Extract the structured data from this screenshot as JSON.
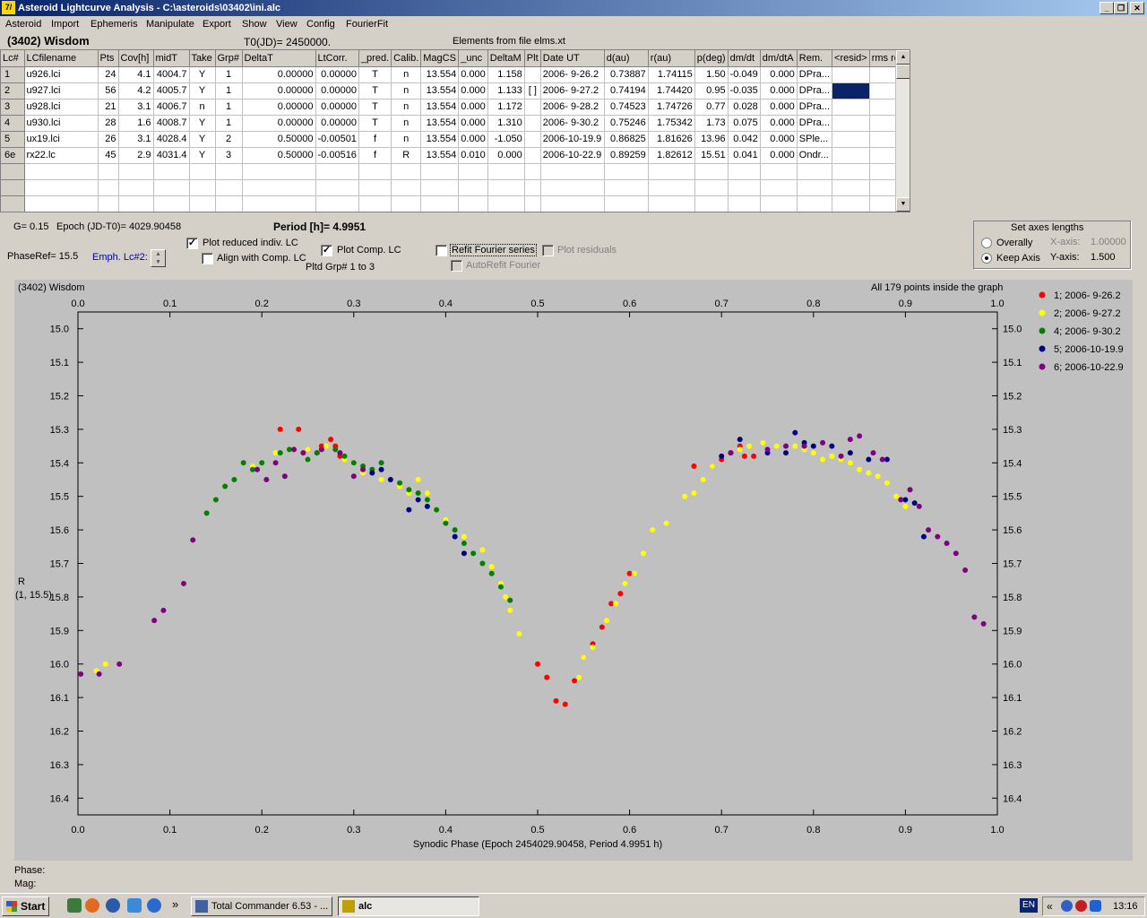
{
  "window": {
    "title": "Asteroid Lightcurve Analysis - C:\\asteroids\\03402\\ini.alc",
    "icon_label": "7/",
    "btn_min": "_",
    "btn_max": "❐",
    "btn_close": "✕"
  },
  "menu": [
    "Asteroid",
    "Import",
    "Ephemeris",
    "Manipulate",
    "Export",
    "Show",
    "View",
    "Config",
    "FourierFit"
  ],
  "header": {
    "asteroid_name": "(3402) Wisdom",
    "t0": "T0(JD)= 2450000.",
    "elements": "Elements from file elms.xt"
  },
  "table": {
    "columns": [
      "Lc#",
      "LCfilename",
      "Pts",
      "Cov[h]",
      "midT",
      "Take",
      "Grp#",
      "DeltaT",
      "LtCorr.",
      "_pred.",
      "Calib.",
      "MagCS",
      "_unc",
      "DeltaM",
      "Plt",
      "Date UT",
      "d(au)",
      "r(au)",
      "p(deg)",
      "dm/dt",
      "dm/dtA",
      "Rem.",
      "<resid>",
      "rms res"
    ],
    "rows": [
      [
        "1",
        "u926.lci",
        "24",
        "4.1",
        "4004.7",
        "Y",
        "1",
        "0.00000",
        "0.00000",
        "T",
        "n",
        "13.554",
        "0.000",
        "1.158",
        "",
        "2006- 9-26.2",
        "0.73887",
        "1.74115",
        "1.50",
        "-0.049",
        "0.000",
        "DPra...",
        "",
        ""
      ],
      [
        "2",
        "u927.lci",
        "56",
        "4.2",
        "4005.7",
        "Y",
        "1",
        "0.00000",
        "0.00000",
        "T",
        "n",
        "13.554",
        "0.000",
        "1.133",
        "[ ]",
        "2006- 9-27.2",
        "0.74194",
        "1.74420",
        "0.95",
        "-0.035",
        "0.000",
        "DPra...",
        "",
        ""
      ],
      [
        "3",
        "u928.lci",
        "21",
        "3.1",
        "4006.7",
        "n",
        "1",
        "0.00000",
        "0.00000",
        "T",
        "n",
        "13.554",
        "0.000",
        "1.172",
        "",
        "2006- 9-28.2",
        "0.74523",
        "1.74726",
        "0.77",
        "0.028",
        "0.000",
        "DPra...",
        "",
        ""
      ],
      [
        "4",
        "u930.lci",
        "28",
        "1.6",
        "4008.7",
        "Y",
        "1",
        "0.00000",
        "0.00000",
        "T",
        "n",
        "13.554",
        "0.000",
        "1.310",
        "",
        "2006- 9-30.2",
        "0.75246",
        "1.75342",
        "1.73",
        "0.075",
        "0.000",
        "DPra...",
        "",
        ""
      ],
      [
        "5",
        "ux19.lci",
        "26",
        "3.1",
        "4028.4",
        "Y",
        "2",
        "0.50000",
        "-0.00501",
        "f",
        "n",
        "13.554",
        "0.000",
        "-1.050",
        "",
        "2006-10-19.9",
        "0.86825",
        "1.81626",
        "13.96",
        "0.042",
        "0.000",
        "SPle...",
        "",
        ""
      ],
      [
        "6e",
        "rx22.lc",
        "45",
        "2.9",
        "4031.4",
        "Y",
        "3",
        "0.50000",
        "-0.00516",
        "f",
        "R",
        "13.554",
        "0.010",
        "0.000",
        "",
        "2006-10-22.9",
        "0.89259",
        "1.82612",
        "15.51",
        "0.041",
        "0.000",
        "Ondr...",
        "",
        ""
      ]
    ],
    "empty_rows": 3,
    "scroll_up": "▲",
    "scroll_down": "▼"
  },
  "params": {
    "g": "G= 0.15",
    "epoch": "Epoch (JD-T0)= 4029.90458",
    "period": "Period [h]= 4.9951",
    "phaseref": "PhaseRef= 15.5",
    "emph": "Emph. Lc#2:",
    "plot_reduced": "Plot reduced indiv. LC",
    "plot_reduced_checked": true,
    "align_comp": "Align with Comp. LC",
    "plot_comp": "Plot Comp. LC",
    "plot_comp_checked": true,
    "refit_fourier": "Refit Fourier series",
    "plot_residuals": "Plot residuals",
    "autorefit": "AutoRefit Fourier",
    "pltd_grp": "Pltd Grp#  1   to    3",
    "check_mark": "✓"
  },
  "axes_box": {
    "title": "Set axes lengths",
    "overally": "Overally",
    "keep_axis": "Keep Axis",
    "x_label": "X-axis:",
    "x_value": "1.00000",
    "y_label": "Y-axis:",
    "y_value": "1.500"
  },
  "status": {
    "phase": "Phase:",
    "mag": "Mag:"
  },
  "chart_data": {
    "type": "scatter",
    "title": "(3402) Wisdom",
    "annotation": "All 179 points inside the graph",
    "xlabel": "Synodic Phase (Epoch 2454029.90458, Period 4.9951 h)",
    "ylabel": "R",
    "ylabel2": "(1, 15.5)",
    "xlim": [
      0.0,
      1.0
    ],
    "ylim": [
      16.45,
      14.95
    ],
    "y_inverted": true,
    "x_ticks": [
      "0.0",
      "0.1",
      "0.2",
      "0.3",
      "0.4",
      "0.5",
      "0.6",
      "0.7",
      "0.8",
      "0.9",
      "1.0"
    ],
    "y_ticks": [
      "15.0",
      "15.1",
      "15.2",
      "15.3",
      "15.4",
      "15.5",
      "15.6",
      "15.7",
      "15.8",
      "15.9",
      "16.0",
      "16.1",
      "16.2",
      "16.3",
      "16.4"
    ],
    "y_tick_values": [
      15.0,
      15.1,
      15.2,
      15.3,
      15.4,
      15.5,
      15.6,
      15.7,
      15.8,
      15.9,
      16.0,
      16.1,
      16.2,
      16.3,
      16.4
    ],
    "grid": false,
    "legend_position": "right",
    "series": [
      {
        "name": "1; 2006- 9-26.2",
        "color": "#ff0000",
        "points": [
          [
            0.22,
            15.3
          ],
          [
            0.24,
            15.3
          ],
          [
            0.25,
            15.36
          ],
          [
            0.26,
            15.37
          ],
          [
            0.265,
            15.35
          ],
          [
            0.275,
            15.33
          ],
          [
            0.28,
            15.35
          ],
          [
            0.285,
            15.38
          ],
          [
            0.5,
            16.0
          ],
          [
            0.51,
            16.04
          ],
          [
            0.52,
            16.11
          ],
          [
            0.53,
            16.12
          ],
          [
            0.54,
            16.05
          ],
          [
            0.55,
            15.98
          ],
          [
            0.56,
            15.94
          ],
          [
            0.57,
            15.89
          ],
          [
            0.58,
            15.82
          ],
          [
            0.59,
            15.79
          ],
          [
            0.6,
            15.73
          ],
          [
            0.67,
            15.41
          ],
          [
            0.69,
            15.41
          ],
          [
            0.7,
            15.39
          ],
          [
            0.71,
            15.37
          ],
          [
            0.72,
            15.35
          ],
          [
            0.725,
            15.38
          ],
          [
            0.735,
            15.38
          ]
        ]
      },
      {
        "name": "2; 2006- 9-27.2",
        "color": "#ffff00",
        "points": [
          [
            0.02,
            16.02
          ],
          [
            0.03,
            16.0
          ],
          [
            0.19,
            15.41
          ],
          [
            0.2,
            15.4
          ],
          [
            0.215,
            15.37
          ],
          [
            0.23,
            15.36
          ],
          [
            0.25,
            15.36
          ],
          [
            0.27,
            15.35
          ],
          [
            0.29,
            15.39
          ],
          [
            0.3,
            15.4
          ],
          [
            0.31,
            15.43
          ],
          [
            0.33,
            15.45
          ],
          [
            0.35,
            15.47
          ],
          [
            0.36,
            15.49
          ],
          [
            0.37,
            15.45
          ],
          [
            0.38,
            15.49
          ],
          [
            0.39,
            15.54
          ],
          [
            0.4,
            15.57
          ],
          [
            0.42,
            15.62
          ],
          [
            0.44,
            15.66
          ],
          [
            0.45,
            15.71
          ],
          [
            0.46,
            15.76
          ],
          [
            0.465,
            15.8
          ],
          [
            0.47,
            15.84
          ],
          [
            0.48,
            15.91
          ],
          [
            0.545,
            16.04
          ],
          [
            0.55,
            15.98
          ],
          [
            0.56,
            15.95
          ],
          [
            0.575,
            15.87
          ],
          [
            0.585,
            15.82
          ],
          [
            0.595,
            15.76
          ],
          [
            0.605,
            15.73
          ],
          [
            0.615,
            15.67
          ],
          [
            0.625,
            15.6
          ],
          [
            0.64,
            15.58
          ],
          [
            0.66,
            15.5
          ],
          [
            0.67,
            15.49
          ],
          [
            0.68,
            15.45
          ],
          [
            0.69,
            15.41
          ],
          [
            0.72,
            15.36
          ],
          [
            0.73,
            15.35
          ],
          [
            0.745,
            15.34
          ],
          [
            0.76,
            15.35
          ],
          [
            0.77,
            15.37
          ],
          [
            0.78,
            15.35
          ],
          [
            0.79,
            15.36
          ],
          [
            0.8,
            15.37
          ],
          [
            0.81,
            15.39
          ],
          [
            0.82,
            15.38
          ],
          [
            0.83,
            15.39
          ],
          [
            0.84,
            15.4
          ],
          [
            0.85,
            15.42
          ],
          [
            0.86,
            15.43
          ],
          [
            0.87,
            15.44
          ],
          [
            0.88,
            15.46
          ],
          [
            0.89,
            15.5
          ],
          [
            0.9,
            15.53
          ]
        ]
      },
      {
        "name": "4; 2006- 9-30.2",
        "color": "#008000",
        "points": [
          [
            0.14,
            15.55
          ],
          [
            0.15,
            15.51
          ],
          [
            0.16,
            15.47
          ],
          [
            0.17,
            15.45
          ],
          [
            0.18,
            15.4
          ],
          [
            0.19,
            15.42
          ],
          [
            0.2,
            15.4
          ],
          [
            0.22,
            15.37
          ],
          [
            0.23,
            15.36
          ],
          [
            0.25,
            15.39
          ],
          [
            0.26,
            15.37
          ],
          [
            0.28,
            15.36
          ],
          [
            0.29,
            15.38
          ],
          [
            0.3,
            15.4
          ],
          [
            0.31,
            15.41
          ],
          [
            0.32,
            15.42
          ],
          [
            0.33,
            15.4
          ],
          [
            0.35,
            15.46
          ],
          [
            0.36,
            15.48
          ],
          [
            0.37,
            15.49
          ],
          [
            0.38,
            15.51
          ],
          [
            0.39,
            15.54
          ],
          [
            0.4,
            15.58
          ],
          [
            0.41,
            15.6
          ],
          [
            0.42,
            15.64
          ],
          [
            0.43,
            15.67
          ],
          [
            0.44,
            15.7
          ],
          [
            0.45,
            15.73
          ],
          [
            0.46,
            15.77
          ],
          [
            0.47,
            15.81
          ]
        ]
      },
      {
        "name": "5; 2006-10-19.9",
        "color": "#000080",
        "points": [
          [
            0.32,
            15.43
          ],
          [
            0.33,
            15.42
          ],
          [
            0.34,
            15.45
          ],
          [
            0.36,
            15.54
          ],
          [
            0.37,
            15.51
          ],
          [
            0.38,
            15.53
          ],
          [
            0.41,
            15.62
          ],
          [
            0.42,
            15.67
          ],
          [
            0.7,
            15.38
          ],
          [
            0.72,
            15.33
          ],
          [
            0.75,
            15.37
          ],
          [
            0.77,
            15.37
          ],
          [
            0.78,
            15.31
          ],
          [
            0.79,
            15.34
          ],
          [
            0.8,
            15.35
          ],
          [
            0.82,
            15.35
          ],
          [
            0.84,
            15.37
          ],
          [
            0.86,
            15.39
          ],
          [
            0.88,
            15.39
          ],
          [
            0.9,
            15.51
          ],
          [
            0.91,
            15.52
          ],
          [
            0.92,
            15.62
          ]
        ]
      },
      {
        "name": "6; 2006-10-22.9",
        "color": "#800080",
        "points": [
          [
            0.003,
            16.03
          ],
          [
            0.023,
            16.03
          ],
          [
            0.045,
            16.0
          ],
          [
            0.083,
            15.87
          ],
          [
            0.093,
            15.84
          ],
          [
            0.115,
            15.76
          ],
          [
            0.125,
            15.63
          ],
          [
            0.195,
            15.42
          ],
          [
            0.205,
            15.45
          ],
          [
            0.215,
            15.4
          ],
          [
            0.225,
            15.44
          ],
          [
            0.235,
            15.36
          ],
          [
            0.245,
            15.37
          ],
          [
            0.265,
            15.36
          ],
          [
            0.285,
            15.37
          ],
          [
            0.3,
            15.44
          ],
          [
            0.31,
            15.42
          ],
          [
            0.71,
            15.37
          ],
          [
            0.75,
            15.36
          ],
          [
            0.77,
            15.35
          ],
          [
            0.79,
            15.35
          ],
          [
            0.81,
            15.34
          ],
          [
            0.83,
            15.38
          ],
          [
            0.84,
            15.33
          ],
          [
            0.85,
            15.32
          ],
          [
            0.865,
            15.37
          ],
          [
            0.875,
            15.39
          ],
          [
            0.895,
            15.51
          ],
          [
            0.905,
            15.48
          ],
          [
            0.915,
            15.53
          ],
          [
            0.925,
            15.6
          ],
          [
            0.935,
            15.62
          ],
          [
            0.945,
            15.64
          ],
          [
            0.955,
            15.67
          ],
          [
            0.965,
            15.72
          ],
          [
            0.975,
            15.86
          ],
          [
            0.985,
            15.88
          ]
        ]
      }
    ]
  },
  "taskbar": {
    "start": "Start",
    "chevron": "»",
    "task1": "Total Commander 6.53 - ...",
    "task2": "alc",
    "lang": "EN",
    "tray_chevron": "«",
    "clock": "13:16"
  }
}
